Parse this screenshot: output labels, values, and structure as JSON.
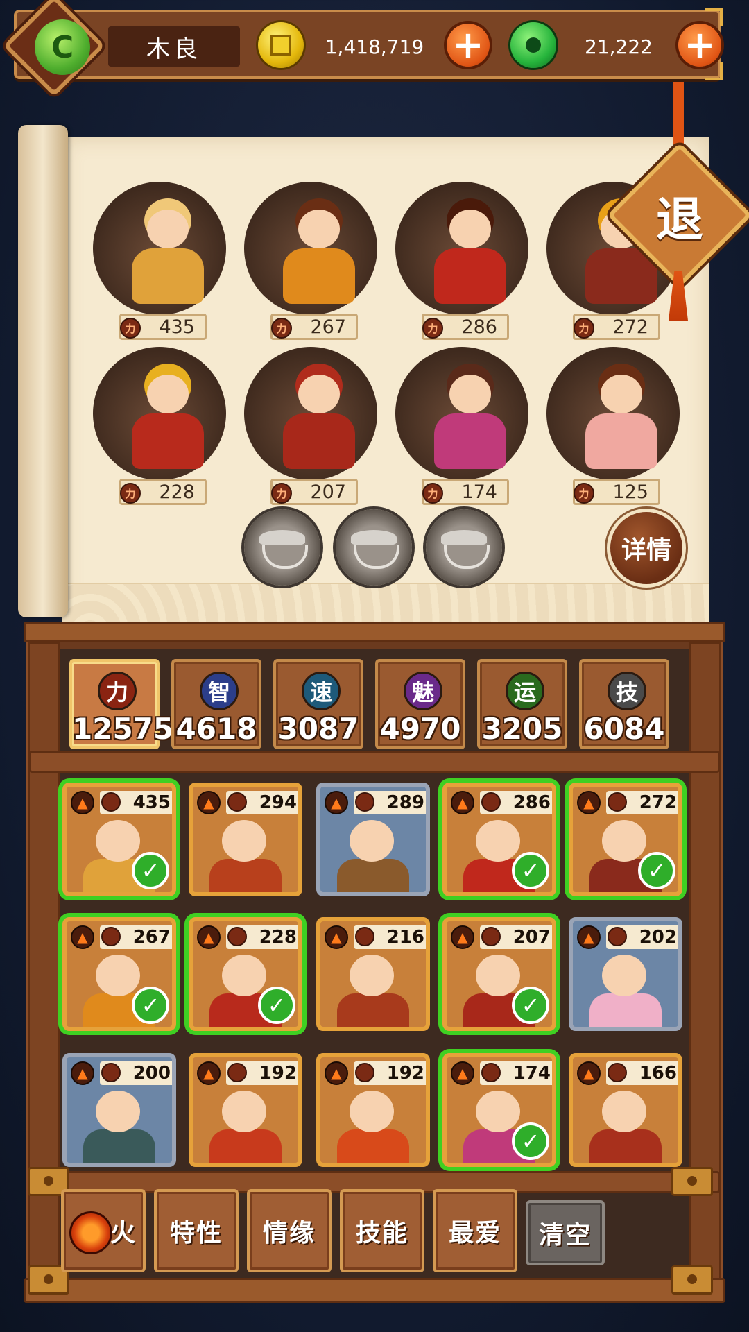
{
  "topbar": {
    "player_name": "木良",
    "gold_amount": "1,418,719",
    "jade_amount": "21,222",
    "plus_label": "+"
  },
  "lineup": {
    "heroes": [
      {
        "power": "435",
        "robe": "#e0a23a",
        "hair": "#f0c878"
      },
      {
        "power": "267",
        "robe": "#e08a1c",
        "hair": "#6a2e14"
      },
      {
        "power": "286",
        "robe": "#c0281c",
        "hair": "#4a1a0a"
      },
      {
        "power": "272",
        "robe": "#8a2a1c",
        "hair": "#e8a018"
      },
      {
        "power": "228",
        "robe": "#b82a1c",
        "hair": "#e8b020"
      },
      {
        "power": "207",
        "robe": "#a8281a",
        "hair": "#b02c1c"
      },
      {
        "power": "174",
        "robe": "#c03a7a",
        "hair": "#5a2a1a"
      },
      {
        "power": "125",
        "robe": "#f0a8a0",
        "hair": "#6a2e14"
      }
    ],
    "detail_label": "详情",
    "exit_label": "退"
  },
  "stats": [
    {
      "icon": "力",
      "value": "12575",
      "color": "#8a2412",
      "active": true
    },
    {
      "icon": "智",
      "value": "4618",
      "color": "#2c3e8a",
      "active": false
    },
    {
      "icon": "速",
      "value": "3087",
      "color": "#1e5a7a",
      "active": false
    },
    {
      "icon": "魅",
      "value": "4970",
      "color": "#6a2a8a",
      "active": false
    },
    {
      "icon": "运",
      "value": "3205",
      "color": "#2a6a1e",
      "active": false
    },
    {
      "icon": "技",
      "value": "6084",
      "color": "#4a4a4a",
      "active": false
    }
  ],
  "roster": [
    {
      "power": "435",
      "selected": true,
      "frame": "gold",
      "robe": "#e0a23a"
    },
    {
      "power": "294",
      "selected": false,
      "frame": "gold",
      "robe": "#b8401c"
    },
    {
      "power": "289",
      "selected": false,
      "frame": "blue",
      "robe": "#8a5a2c"
    },
    {
      "power": "286",
      "selected": true,
      "frame": "gold",
      "robe": "#c0281c"
    },
    {
      "power": "272",
      "selected": true,
      "frame": "gold",
      "robe": "#8a2a1c"
    },
    {
      "power": "267",
      "selected": true,
      "frame": "gold",
      "robe": "#e08a1c"
    },
    {
      "power": "228",
      "selected": true,
      "frame": "gold",
      "robe": "#b82a1c"
    },
    {
      "power": "216",
      "selected": false,
      "frame": "gold",
      "robe": "#a83a1c"
    },
    {
      "power": "207",
      "selected": true,
      "frame": "gold",
      "robe": "#a8281a"
    },
    {
      "power": "202",
      "selected": false,
      "frame": "blue",
      "robe": "#f0b0c8"
    },
    {
      "power": "200",
      "selected": false,
      "frame": "blue",
      "robe": "#3a5a5a"
    },
    {
      "power": "192",
      "selected": false,
      "frame": "gold",
      "robe": "#c83a1c"
    },
    {
      "power": "192",
      "selected": false,
      "frame": "gold",
      "robe": "#d84a1a"
    },
    {
      "power": "174",
      "selected": true,
      "frame": "gold",
      "robe": "#c03a7a"
    },
    {
      "power": "166",
      "selected": false,
      "frame": "red",
      "robe": "#a8301c"
    }
  ],
  "filters": {
    "element": "火",
    "trait": "特性",
    "bond": "情缘",
    "skill": "技能",
    "favorite": "最爱",
    "clear": "清空"
  }
}
